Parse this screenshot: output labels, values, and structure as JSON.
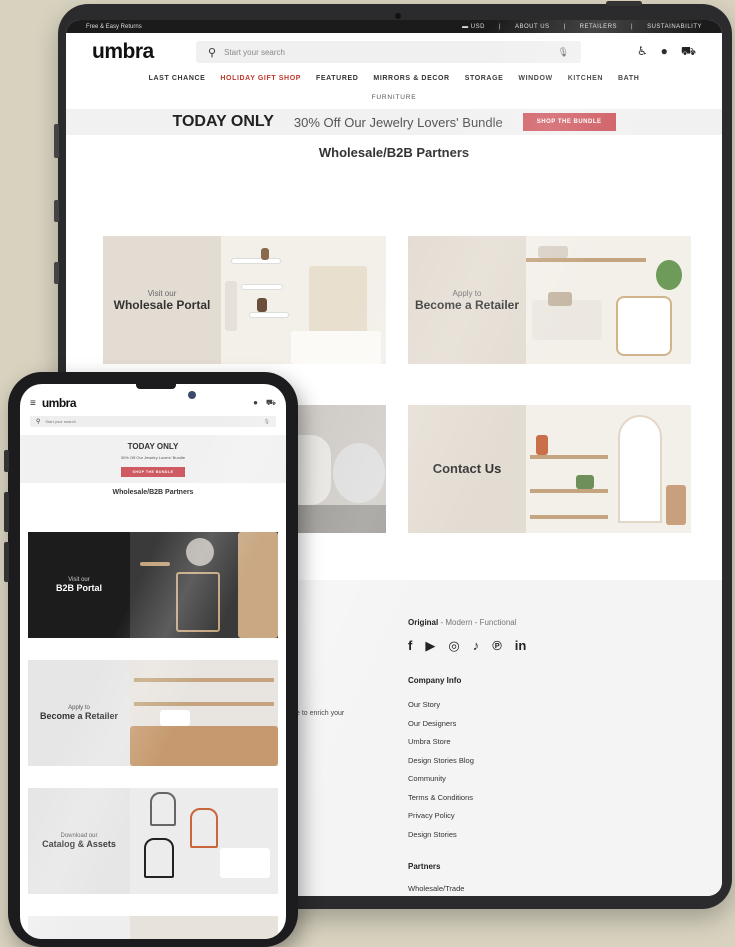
{
  "tablet": {
    "topbar": {
      "left": "Free & Easy Returns",
      "links": [
        "USD",
        "|",
        "ABOUT US",
        "|",
        "RETAILERS",
        "|",
        "SUSTAINABILITY"
      ]
    },
    "logo": "umbra",
    "search_placeholder": "Start your search",
    "nav": [
      "LAST CHANCE",
      "HOLIDAY GIFT SHOP",
      "FEATURED",
      "MIRRORS & DECOR",
      "STORAGE",
      "WINDOW",
      "KITCHEN",
      "BATH"
    ],
    "nav2": "FURNITURE",
    "promo": {
      "big": "TODAY ONLY",
      "small": "30% Off Our Jewelry Lovers' Bundle",
      "button": "SHOP THE BUNDLE"
    },
    "heading": "Wholesale/B2B Partners",
    "cards": [
      {
        "pre": "Visit our",
        "main": "Wholesale Portal"
      },
      {
        "pre": "Apply to",
        "main": "Become a Retailer"
      },
      {
        "pre": "",
        "main": ""
      },
      {
        "pre": "",
        "main": "Contact Us"
      }
    ],
    "footer": {
      "tag_bold": "Original",
      "tag_rest": " - Modern - Functional",
      "social": [
        "f",
        "▶",
        "◎",
        "♪",
        "℗",
        "in"
      ],
      "company_title": "Company Info",
      "company_links": [
        "Our Story",
        "Our Designers",
        "Umbra Store",
        "Design Stories Blog",
        "Community",
        "Terms & Conditions",
        "Privacy Policy",
        "Design Stories"
      ],
      "partners_title": "Partners",
      "partners_first": "Wholesale/Trade",
      "enrich": "e to enrich your"
    }
  },
  "phone": {
    "logo": "umbra",
    "search_placeholder": "Start your search",
    "promo": {
      "big": "TODAY ONLY",
      "small": "30% Off Our Jewelry Lovers' Bundle",
      "button": "SHOP THE BUNDLE"
    },
    "heading": "Wholesale/B2B Partners",
    "cards": [
      {
        "pre": "Visit our",
        "main": "B2B Portal"
      },
      {
        "pre": "Apply to",
        "main": "Become a Retailer"
      },
      {
        "pre": "Download our",
        "main": "Catalog & Assets"
      }
    ]
  },
  "colors": {
    "background": "#d8d2bf",
    "accent": "#cf5b62",
    "sale": "#c0392b"
  }
}
